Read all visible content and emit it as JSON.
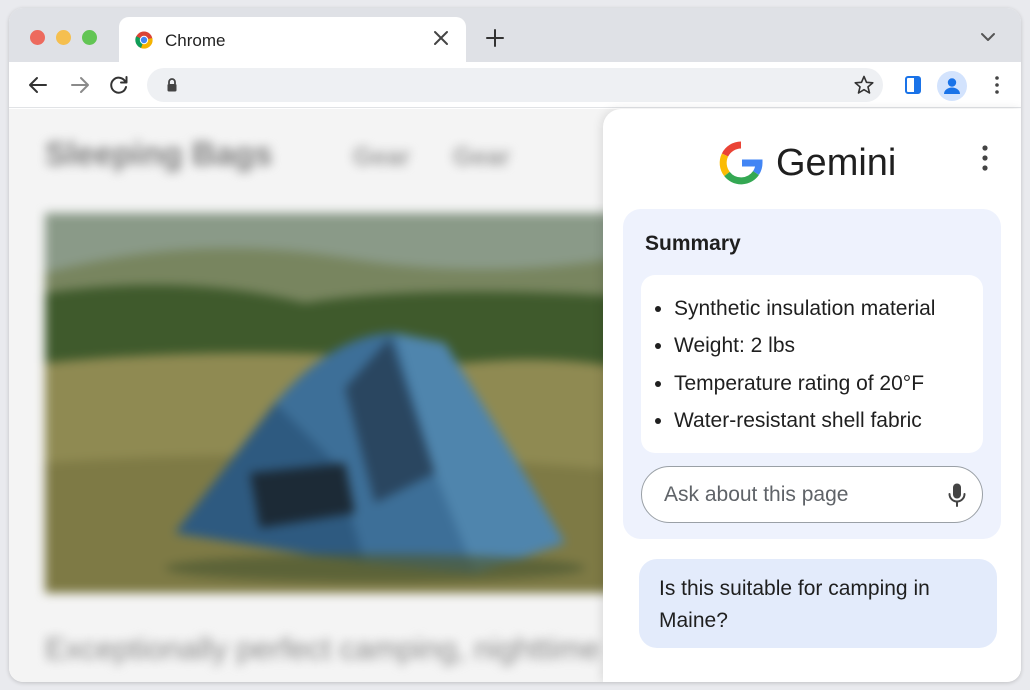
{
  "browser": {
    "tab": {
      "title": "Chrome",
      "icon": "chrome-icon"
    },
    "toolbar": {
      "icons": [
        "back-arrow-icon",
        "forward-arrow-icon",
        "reload-icon",
        "lock-icon",
        "bookmark-star-icon",
        "side-panel-icon",
        "profile-avatar-icon",
        "kebab-menu-icon"
      ]
    }
  },
  "page": {
    "title": "Sleeping Bags",
    "nav": [
      "Gear",
      "Gear"
    ],
    "caption": "Exceptionally perfect camping, nighttime"
  },
  "gemini": {
    "brand": "Gemini",
    "summary": {
      "title": "Summary",
      "items": [
        "Synthetic insulation material",
        "Weight: 2 lbs",
        "Temperature rating of 20°F",
        "Water-resistant shell fabric"
      ]
    },
    "ask": {
      "placeholder": "Ask about this page"
    },
    "user_message": "Is this suitable for camping in Maine?"
  },
  "colors": {
    "accent": "#1a73e8",
    "panel_bg": "#eef2fd",
    "user_bubble": "#e3ebfb"
  }
}
